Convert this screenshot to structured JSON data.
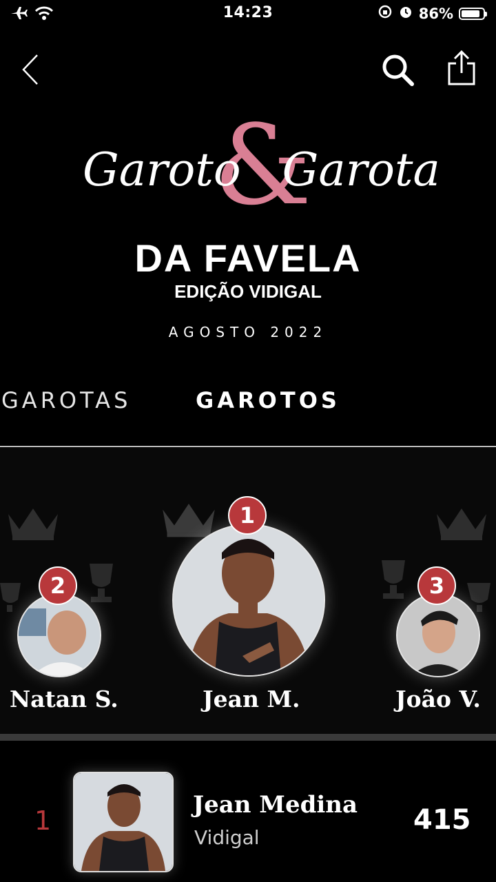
{
  "status": {
    "time": "14:23",
    "battery_text": "86%",
    "battery_level": 0.86
  },
  "logo": {
    "script_left": "Garoto",
    "ampersand": "&",
    "script_right": "Garota",
    "title": "DA FAVELA",
    "edition": "EDIÇÃO VIDIGAL",
    "date": "AGOSTO 2022"
  },
  "tabs": [
    {
      "label": "GAROTAS",
      "active": false
    },
    {
      "label": "GAROTOS",
      "active": true
    }
  ],
  "podium": [
    {
      "rank": "2",
      "name": "Natan S."
    },
    {
      "rank": "1",
      "name": "Jean M."
    },
    {
      "rank": "3",
      "name": "João V."
    }
  ],
  "ranking": [
    {
      "rank": "1",
      "name": "Jean Medina",
      "location": "Vidigal",
      "votes": "415"
    }
  ],
  "colors": {
    "accent_pink": "#d97f94",
    "badge_red": "#b8383b",
    "background": "#000000"
  },
  "icons": [
    "airplane-icon",
    "wifi-icon",
    "rotation-lock-icon",
    "alarm-icon",
    "battery-icon",
    "back-chevron-icon",
    "search-icon",
    "share-icon",
    "crown-icon",
    "trophy-icon"
  ]
}
